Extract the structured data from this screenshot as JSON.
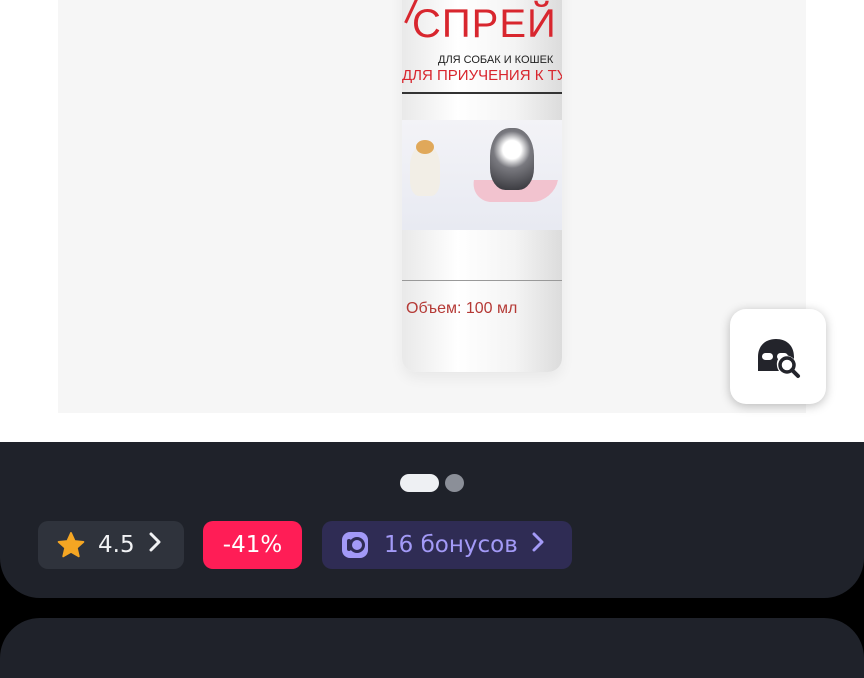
{
  "product_image": {
    "label_title": "СПРЕЙ",
    "label_subtitle": "ДЛЯ СОБАК И КОШЕК",
    "label_purpose": "ДЛЯ ПРИУЧЕНИЯ К ТУАЛЕТУ",
    "label_volume": "Объем: 100 мл"
  },
  "image_search_button": {
    "icon": "image-search-icon"
  },
  "carousel": {
    "total": 2,
    "active_index": 0
  },
  "badges": {
    "rating": {
      "icon": "star-icon",
      "value": "4.5",
      "star_color": "#f5a623"
    },
    "discount": {
      "value": "-41%",
      "color": "#ff1d56"
    },
    "bonus": {
      "icon": "bonus-icon",
      "label": "16 бонусов",
      "color": "#a39af7"
    }
  }
}
